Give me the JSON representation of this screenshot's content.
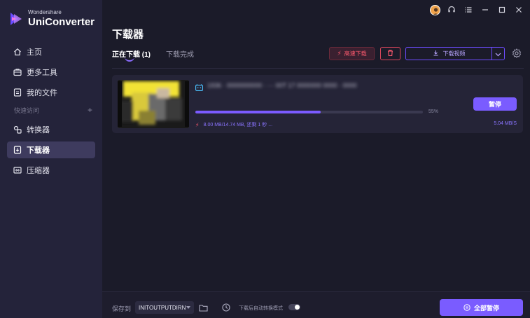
{
  "app": {
    "brand": "Wondershare",
    "name": "UniConverter"
  },
  "sidebar": {
    "items": [
      {
        "label": "主页",
        "icon": "home-icon"
      },
      {
        "label": "更多工具",
        "icon": "toolbox-icon"
      },
      {
        "label": "我的文件",
        "icon": "files-icon"
      }
    ],
    "section_label": "快速访问",
    "quick": [
      {
        "label": "转换器",
        "icon": "converter-icon"
      },
      {
        "label": "下载器",
        "icon": "downloader-icon",
        "active": true
      },
      {
        "label": "压缩器",
        "icon": "compressor-icon"
      }
    ]
  },
  "page": {
    "title": "下载器",
    "tabs": [
      {
        "label": "正在下载 (1)",
        "active": true
      },
      {
        "label": "下载完成",
        "active": false
      }
    ],
    "turbo_label": "高速下载",
    "download_label": "下载视频"
  },
  "download_item": {
    "file_name": "1936 · 0000000000 · ··· 00T 17 0000000 0000 · 0000",
    "progress_percent": 55,
    "progress_label": "55%",
    "meta_text": "8.00 MB/14.74 MB, 还剩 1 秒 ...",
    "speed": "5.04 MB/S",
    "pause_label": "暂停"
  },
  "footer": {
    "save_to_label": "保存到",
    "save_path": "INITOUTPUTDIRN",
    "convert_mode_label": "下载后自动转换模式",
    "pause_all_label": "全部暂停"
  },
  "colors": {
    "accent": "#7a5cff",
    "danger": "#ff5a6e",
    "sidebar_bg": "#24233a",
    "main_bg": "#1b1b29"
  }
}
